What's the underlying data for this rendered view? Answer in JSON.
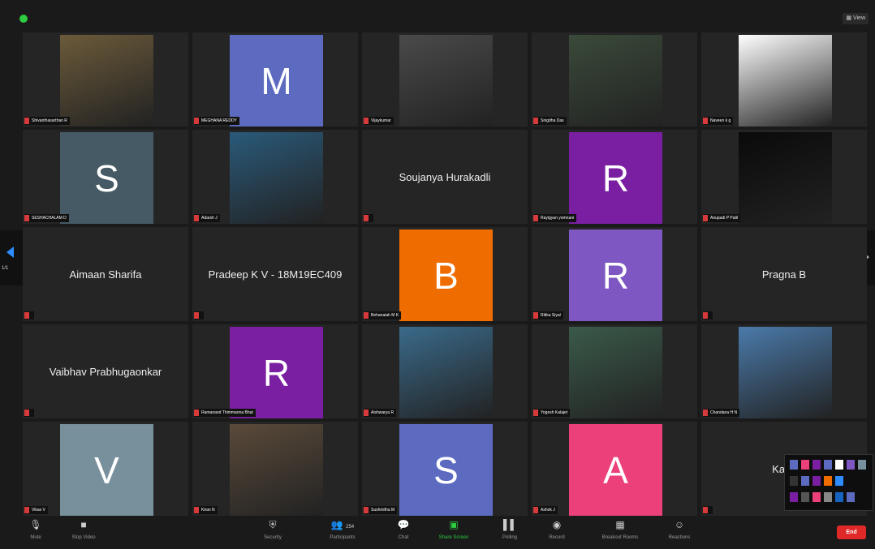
{
  "topbar": {
    "view_label": "View"
  },
  "pagination": {
    "left_label": "1/1"
  },
  "tiles": [
    {
      "label": "Shivanthasarthan R",
      "type": "photo"
    },
    {
      "label": "MEGHANA REDDY",
      "type": "avatar",
      "letter": "M",
      "color": "#5c6bc0"
    },
    {
      "label": "Vijaykumar",
      "type": "photo"
    },
    {
      "label": "Snigdha Das",
      "type": "photo"
    },
    {
      "label": "Naveen k g",
      "type": "photo"
    },
    {
      "label": "SESHACHALAM D",
      "type": "avatar",
      "letter": "S",
      "color": "#455a64"
    },
    {
      "label": "Adarsh J",
      "type": "photo"
    },
    {
      "label": "",
      "type": "name",
      "name": "Soujanya Hurakadli"
    },
    {
      "label": "Rayigyan yomnani",
      "type": "avatar",
      "letter": "R",
      "color": "#7b1fa2"
    },
    {
      "label": "Anupadi P Patil",
      "type": "photo"
    },
    {
      "label": "",
      "type": "name",
      "name": "Aimaan Sharifa"
    },
    {
      "label": "",
      "type": "name",
      "name": "Pradeep K V - 18M19EC409"
    },
    {
      "label": "Behanaiah M K",
      "type": "avatar",
      "letter": "B",
      "color": "#ef6c00"
    },
    {
      "label": "Ritika Siyal",
      "type": "avatar",
      "letter": "R",
      "color": "#7e57c2"
    },
    {
      "label": "",
      "type": "name",
      "name": "Pragna B"
    },
    {
      "label": "",
      "type": "name",
      "name": "Vaibhav Prabhugaonkar"
    },
    {
      "label": "Ramanand Thimmanna Bhat",
      "type": "avatar",
      "letter": "R",
      "color": "#7b1fa2"
    },
    {
      "label": "Aishwarya R",
      "type": "photo"
    },
    {
      "label": "Yogesh Kalajet",
      "type": "photo"
    },
    {
      "label": "Chandana H N",
      "type": "photo"
    },
    {
      "label": "Vikas V",
      "type": "avatar",
      "letter": "V",
      "color": "#78909c"
    },
    {
      "label": "Kiran N",
      "type": "photo"
    },
    {
      "label": "Sushmitha M",
      "type": "avatar",
      "letter": "S",
      "color": "#5c6bc0"
    },
    {
      "label": "Ashok J",
      "type": "avatar",
      "letter": "A",
      "color": "#ec407a"
    },
    {
      "label": "",
      "type": "name",
      "name": "Kave"
    }
  ],
  "toolbar": {
    "mute": "Mute",
    "stop_video": "Stop Video",
    "security": "Security",
    "participants": "Participants",
    "participants_count": "254",
    "chat": "Chat",
    "share_screen": "Share Screen",
    "polling": "Polling",
    "record": "Record",
    "breakout_rooms": "Breakout Rooms",
    "reactions": "Reactions",
    "end": "End"
  }
}
